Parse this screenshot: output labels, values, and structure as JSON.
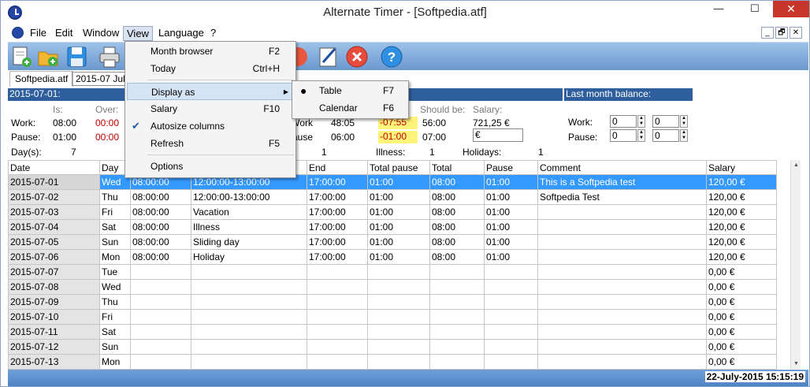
{
  "window": {
    "title": "Alternate Timer - [Softpedia.atf]",
    "minimize": "—",
    "maximize": "☐",
    "close": "✕"
  },
  "menu": {
    "items": [
      "File",
      "Edit",
      "Window",
      "View",
      "Language",
      "?"
    ],
    "mdi_buttons": [
      "_",
      "🗗",
      "✕"
    ]
  },
  "toolbar": {
    "icons": [
      "new-icon",
      "open-icon",
      "save-icon",
      "print-icon",
      "stop-icon",
      "edit-icon",
      "close-red-icon",
      "help-icon"
    ]
  },
  "tabs": {
    "file": "Softpedia.atf",
    "month_select": "2015-07 July"
  },
  "summary": {
    "date_header": "2015-07-01:",
    "is_label": "Is:",
    "over_label": "Over:",
    "work_label": "Work:",
    "pause_label": "Pause:",
    "work_is": "08:00",
    "work_over": "00:00",
    "pause_is": "01:00",
    "pause_over": "00:00",
    "month_work": "Work:",
    "month_work_is": "48:05",
    "month_work_over": "-07:55",
    "month_pause": "Pause:",
    "month_pause_is": "06:00",
    "month_pause_over": "-01:00",
    "should_be_label": "Should be:",
    "salary_label": "Salary:",
    "should_be_work": "56:00",
    "should_be_pause": "07:00",
    "salary_value": "721,25 €",
    "salary_input": "€",
    "days_label": "Day(s):",
    "days_value": "7",
    "vacation_count": "1",
    "illness_label": "Illness:",
    "illness_value": "1",
    "holidays_label": "Holidays:",
    "holidays_value": "1"
  },
  "last_month": {
    "header": "Last month balance:",
    "work_label": "Work:",
    "pause_label": "Pause:",
    "work_h": "0",
    "work_m": "0",
    "pause_h": "0",
    "pause_m": "0"
  },
  "grid": {
    "headers": [
      "Date",
      "Day",
      "",
      "",
      "End",
      "Total pause",
      "Total",
      "Pause",
      "Comment",
      "Salary"
    ],
    "rows": [
      [
        "2015-07-01",
        "Wed",
        "08:00:00",
        "12:00:00-13:00:00",
        "17:00:00",
        "01:00",
        "08:00",
        "01:00",
        "This is a Softpedia test",
        "120,00 €"
      ],
      [
        "2015-07-02",
        "Thu",
        "08:00:00",
        "12:00:00-13:00:00",
        "17:00:00",
        "01:00",
        "08:00",
        "01:00",
        "Softpedia Test",
        "120,00 €"
      ],
      [
        "2015-07-03",
        "Fri",
        "08:00:00",
        "Vacation",
        "17:00:00",
        "01:00",
        "08:00",
        "01:00",
        "",
        "120,00 €"
      ],
      [
        "2015-07-04",
        "Sat",
        "08:00:00",
        "Illness",
        "17:00:00",
        "01:00",
        "08:00",
        "01:00",
        "",
        "120,00 €"
      ],
      [
        "2015-07-05",
        "Sun",
        "08:00:00",
        "Sliding day",
        "17:00:00",
        "01:00",
        "08:00",
        "01:00",
        "",
        "120,00 €"
      ],
      [
        "2015-07-06",
        "Mon",
        "08:00:00",
        "Holiday",
        "17:00:00",
        "01:00",
        "08:00",
        "01:00",
        "",
        "120,00 €"
      ],
      [
        "2015-07-07",
        "Tue",
        "",
        "",
        "",
        "",
        "",
        "",
        "",
        "0,00 €"
      ],
      [
        "2015-07-08",
        "Wed",
        "",
        "",
        "",
        "",
        "",
        "",
        "",
        "0,00 €"
      ],
      [
        "2015-07-09",
        "Thu",
        "",
        "",
        "",
        "",
        "",
        "",
        "",
        "0,00 €"
      ],
      [
        "2015-07-10",
        "Fri",
        "",
        "",
        "",
        "",
        "",
        "",
        "",
        "0,00 €"
      ],
      [
        "2015-07-11",
        "Sat",
        "",
        "",
        "",
        "",
        "",
        "",
        "",
        "0,00 €"
      ],
      [
        "2015-07-12",
        "Sun",
        "",
        "",
        "",
        "",
        "",
        "",
        "",
        "0,00 €"
      ],
      [
        "2015-07-13",
        "Mon",
        "",
        "",
        "",
        "",
        "",
        "",
        "",
        "0,00 €"
      ]
    ]
  },
  "status": {
    "datetime": "22-July-2015  15:15:19"
  },
  "view_menu": {
    "month_browser": "Month browser",
    "month_browser_key": "F2",
    "today": "Today",
    "today_key": "Ctrl+H",
    "display_as": "Display as",
    "salary": "Salary",
    "salary_key": "F10",
    "autosize": "Autosize columns",
    "refresh": "Refresh",
    "refresh_key": "F5",
    "options": "Options"
  },
  "display_submenu": {
    "table": "Table",
    "table_key": "F7",
    "calendar": "Calendar",
    "calendar_key": "F6"
  }
}
